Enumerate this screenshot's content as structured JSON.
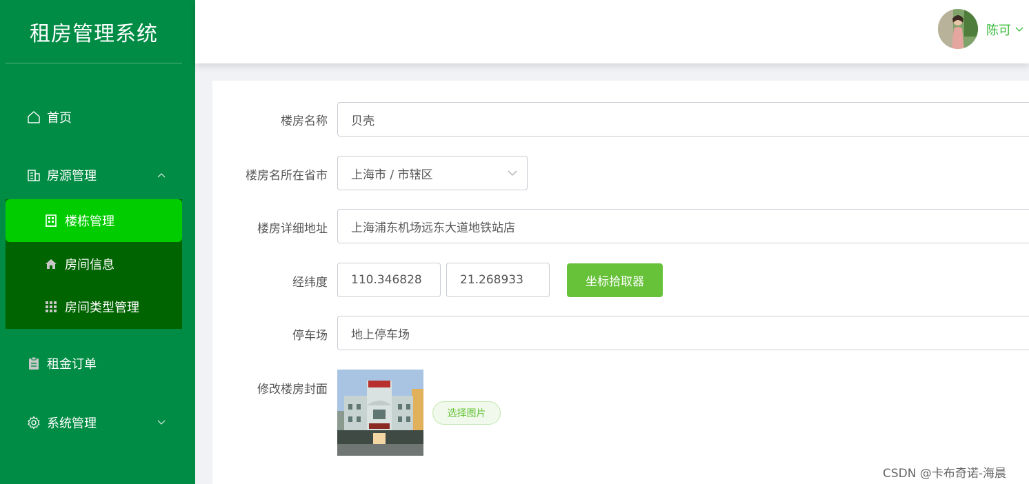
{
  "app": {
    "title": "租房管理系统"
  },
  "sidebar": {
    "items": [
      {
        "label": "首页",
        "icon": "home-icon"
      },
      {
        "label": "房源管理",
        "icon": "building-icon",
        "expanded": true
      },
      {
        "label": "租金订单",
        "icon": "clipboard-icon"
      },
      {
        "label": "系统管理",
        "icon": "gear-icon",
        "expanded": false
      }
    ],
    "sub_items": [
      {
        "label": "楼栋管理",
        "icon": "building-outline-icon",
        "active": true
      },
      {
        "label": "房间信息",
        "icon": "house-icon"
      },
      {
        "label": "房间类型管理",
        "icon": "grid-icon"
      }
    ]
  },
  "header": {
    "user_name": "陈可"
  },
  "form": {
    "name_label": "楼房名称",
    "name_value": "贝壳",
    "region_label": "楼房名所在省市",
    "region_value": "上海市 / 市辖区",
    "address_label": "楼房详细地址",
    "address_value": "上海浦东机场远东大道地铁站店",
    "coords_label": "经纬度",
    "longitude_value": "110.346828",
    "latitude_value": "21.268933",
    "coord_picker_label": "坐标拾取器",
    "parking_label": "停车场",
    "parking_value": "地上停车场",
    "cover_label": "修改楼房封面",
    "choose_image_label": "选择图片"
  },
  "watermark": "CSDN @卡布奇诺-海晨",
  "colors": {
    "sidebar_bg": "#008c44",
    "submenu_bg": "#006400",
    "active_bg": "#00cc00",
    "accent_green": "#67c23a",
    "username_green": "#33b833"
  }
}
